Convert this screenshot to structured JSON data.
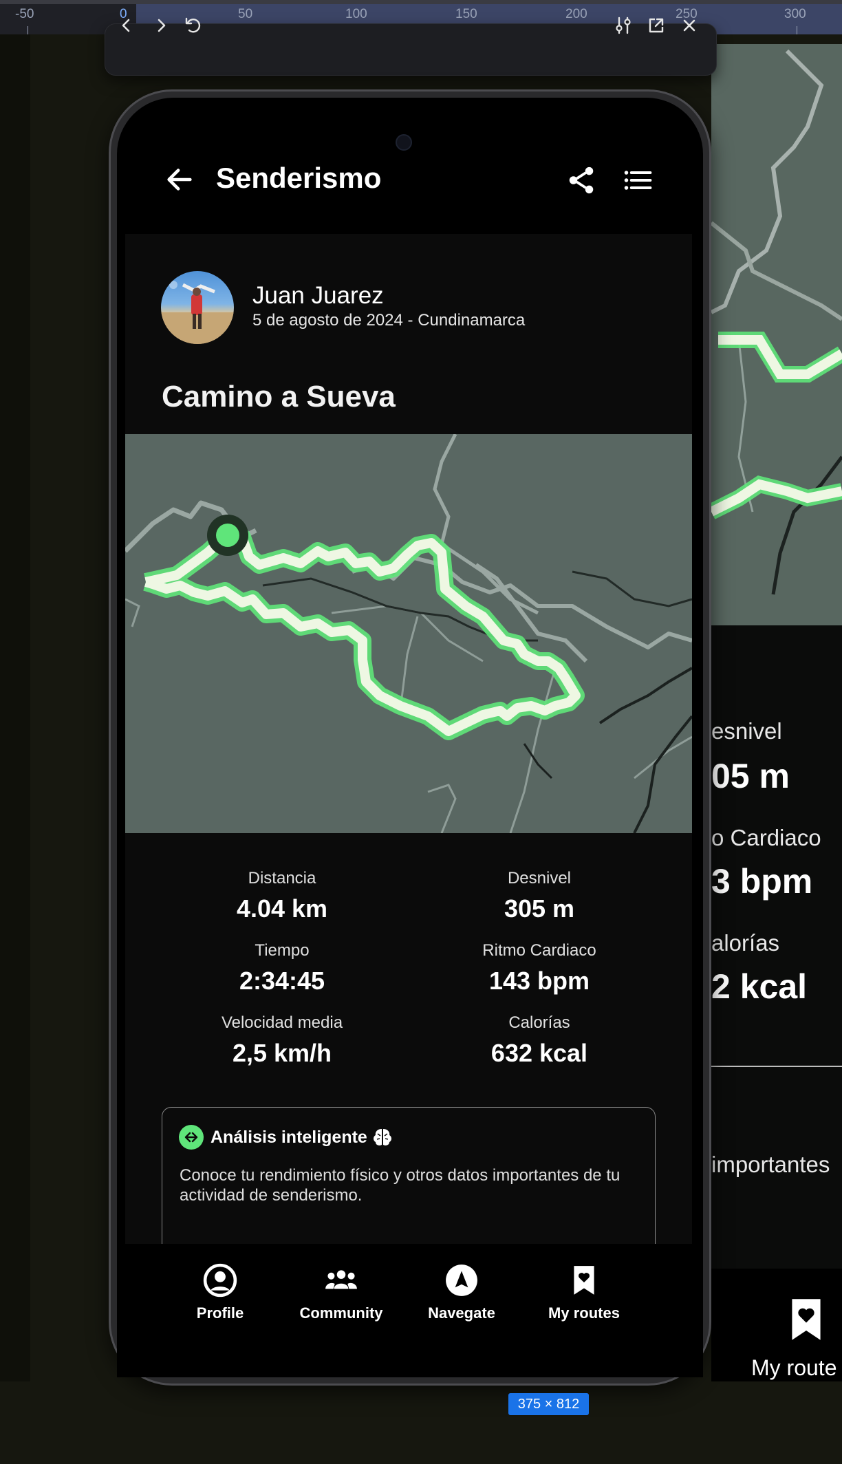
{
  "ruler": {
    "labels": [
      "-50",
      "0",
      "50",
      "100",
      "150",
      "200",
      "250",
      "300"
    ]
  },
  "devtools": {
    "back_icon": "chevron-left-icon",
    "forward_icon": "chevron-right-icon",
    "reload_icon": "rotate-ccw-icon",
    "settings_icon": "sliders-icon",
    "popout_icon": "external-link-icon",
    "close_icon": "close-icon",
    "device_size": "375 × 812"
  },
  "app": {
    "title": "Senderismo",
    "back_icon": "arrow-left-icon",
    "share_icon": "share-icon",
    "menu_icon": "list-icon",
    "user": {
      "name": "Juan Juarez",
      "meta": "5 de agosto de 2024 - Cundinamarca"
    },
    "route_title": "Camino a Sueva",
    "stats": [
      {
        "label": "Distancia",
        "value": "4.04 km"
      },
      {
        "label": "Desnivel",
        "value": "305 m"
      },
      {
        "label": "Tiempo",
        "value": "2:34:45"
      },
      {
        "label": "Ritmo Cardiaco",
        "value": "143 bpm"
      },
      {
        "label": "Velocidad media",
        "value": "2,5 km/h"
      },
      {
        "label": "Calorías",
        "value": "632 kcal"
      }
    ],
    "analysis": {
      "title": "Análisis inteligente",
      "body": "Conoce tu rendimiento físico y otros datos importantes de tu actividad de senderismo."
    },
    "nav": [
      {
        "label": "Profile",
        "icon": "user-circle-icon"
      },
      {
        "label": "Community",
        "icon": "users-icon"
      },
      {
        "label": "Navegate",
        "icon": "navigation-icon"
      },
      {
        "label": "My routes",
        "icon": "bookmark-heart-icon"
      }
    ]
  },
  "background_app": {
    "texts": [
      "esnivel",
      "05 m",
      "o Cardiaco",
      "3 bpm",
      "alorías",
      "2 kcal",
      "importantes",
      "My route"
    ]
  },
  "colors": {
    "accent": "#5fe57a",
    "map_bg": "#596762",
    "route_stroke": "#eef7e3",
    "devtools_blue": "#1a73e8"
  }
}
